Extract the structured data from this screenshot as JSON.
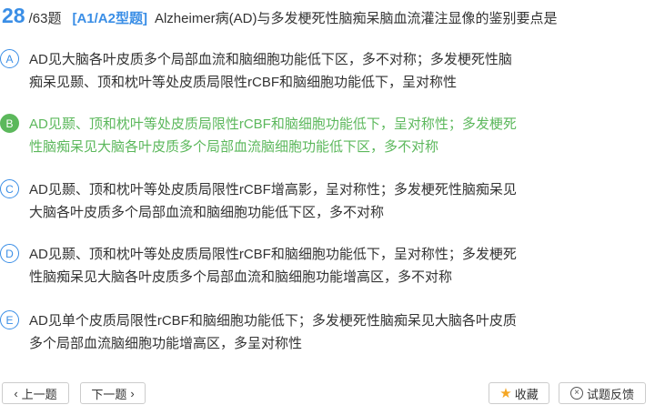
{
  "question": {
    "number": "28",
    "total": "/63题",
    "type": "[A1/A2型题]",
    "stem": "Alzheimer病(AD)与多发梗死性脑痴呆脑血流灌注显像的鉴别要点是"
  },
  "options": [
    {
      "letter": "A",
      "line1": "AD见大脑各叶皮质多个局部血流和脑细胞功能低下区，多不对称；多发梗死性脑",
      "line2": "痴呆见颞、顶和枕叶等处皮质局限性rCBF和脑细胞功能低下，呈对称性"
    },
    {
      "letter": "B",
      "line1": "AD见颞、顶和枕叶等处皮质局限性rCBF和脑细胞功能低下，呈对称性；多发梗死",
      "line2": "性脑痴呆见大脑各叶皮质多个局部血流脑细胞功能低下区，多不对称"
    },
    {
      "letter": "C",
      "line1": "AD见颞、顶和枕叶等处皮质局限性rCBF增高影，呈对称性；多发梗死性脑痴呆见",
      "line2": "大脑各叶皮质多个局部血流和脑细胞功能低下区，多不对称"
    },
    {
      "letter": "D",
      "line1": "AD见颞、顶和枕叶等处皮质局限性rCBF和脑细胞功能低下，呈对称性；多发梗死",
      "line2": "性脑痴呆见大脑各叶皮质多个局部血流和脑细胞功能增高区，多不对称"
    },
    {
      "letter": "E",
      "line1": "AD见单个皮质局限性rCBF和脑细胞功能低下；多发梗死性脑痴呆见大脑各叶皮质",
      "line2": "多个局部血流脑细胞功能增高区，多呈对称性"
    }
  ],
  "correct_option": "B",
  "colors": {
    "accent": "#3a8ee6",
    "correct": "#5cb85c",
    "star": "#f5a623"
  },
  "buttons": {
    "prev": "上一题",
    "next": "下一题",
    "favorite": "收藏",
    "feedback": "试题反馈"
  },
  "icons": {
    "prev": "chevron-left-icon",
    "next": "chevron-right-icon",
    "favorite": "star-icon",
    "feedback": "close-circle-icon"
  }
}
